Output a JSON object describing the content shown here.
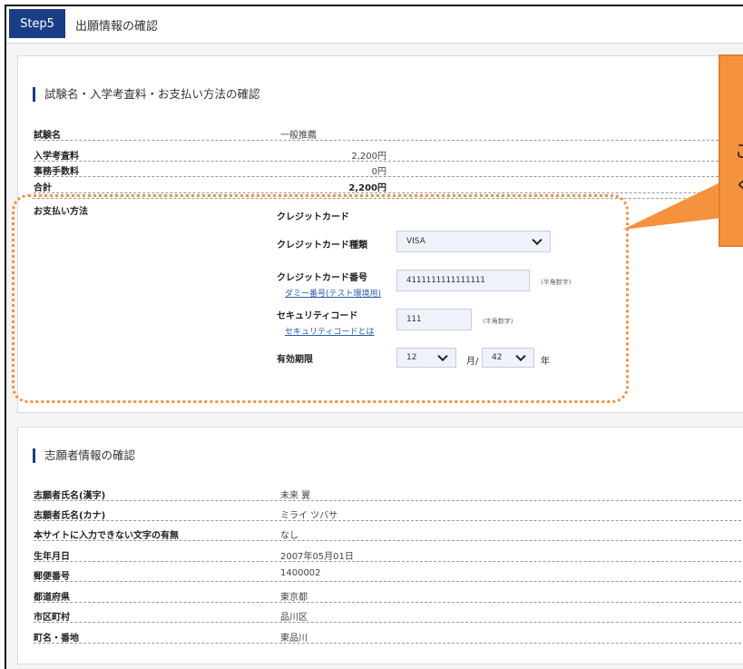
{
  "header": {
    "step": "Step5",
    "title": "出願情報の確認"
  },
  "exam_section": {
    "title": "試験名・入学考査料・お支払い方法の確認",
    "rows": [
      {
        "label": "試験名",
        "value": "一般推薦"
      },
      {
        "label": "入学考査料",
        "amount": "2,200円"
      },
      {
        "label": "事務手数料",
        "amount": "0円"
      },
      {
        "label": "合計",
        "amount": "2,200円"
      }
    ],
    "payment_label": "お支払い方法",
    "payment_method": "クレジットカード",
    "card_type_label": "クレジットカード種類",
    "card_type_value": "VISA",
    "card_number_label": "クレジットカード番号",
    "card_number_value": "4111111111111111",
    "card_number_hint": "(半角数字)",
    "card_number_link": "ダミー番号(テスト環境用)",
    "security_label": "セキュリティコード",
    "security_value": "111",
    "security_hint": "(半角数字)",
    "security_link": "セキュリティコードとは",
    "expiry_label": "有効期限",
    "expiry_month": "12",
    "expiry_month_unit": "月/",
    "expiry_year": "42",
    "expiry_year_unit": "年"
  },
  "applicant_section": {
    "title": "志願者情報の確認",
    "rows": [
      {
        "label": "志願者氏名(漢字)",
        "value": "未来 翼"
      },
      {
        "label": "志願者氏名(カナ)",
        "value": "ミライ ツバサ"
      },
      {
        "label": "本サイトに入力できない文字の有無",
        "value": "なし"
      },
      {
        "label": "生年月日",
        "value": "2007年05月01日"
      },
      {
        "label": "郵便番号",
        "value": "1400002"
      },
      {
        "label": "都道府県",
        "value": "東京都"
      },
      {
        "label": "市区町村",
        "value": "品川区"
      },
      {
        "label": "町名・番地",
        "value": "東品川"
      }
    ]
  },
  "callout": {
    "fragment_1": "ご",
    "fragment_2": "く"
  },
  "colors": {
    "accent": "#1a3e86",
    "callout": "#f5923e",
    "link": "#2a5caa"
  }
}
